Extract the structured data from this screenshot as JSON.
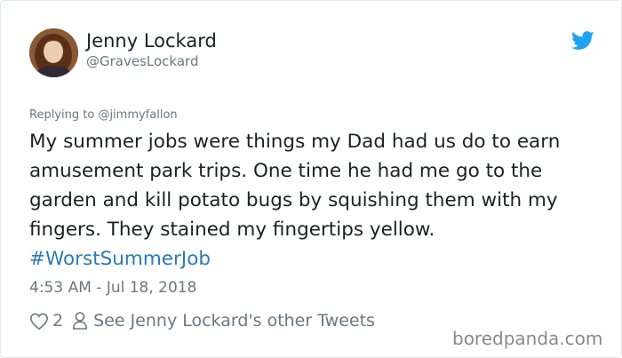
{
  "tweet": {
    "author_name": "Jenny Lockard",
    "author_handle": "@GravesLockard",
    "reply_prefix": "Replying to ",
    "reply_to": "@jimmyfallon",
    "text_main": "My summer jobs were things my Dad had us do to earn amusement park trips. One time he had me go to the garden and kill potato bugs by squishing them with my fingers. They stained my fingertips yellow. ",
    "hashtag": "#WorstSummerJob",
    "timestamp": "4:53 AM - Jul 18, 2018",
    "like_count": "2",
    "other_tweets_label": "See Jenny Lockard's other Tweets"
  },
  "icons": {
    "brand": "twitter-bird-icon",
    "like": "heart-icon",
    "profile": "person-icon"
  },
  "colors": {
    "text": "#1c2022",
    "secondary": "#697882",
    "link": "#2b7bb9",
    "twitter_blue": "#1da1f2"
  },
  "watermark": "boredpanda.com"
}
